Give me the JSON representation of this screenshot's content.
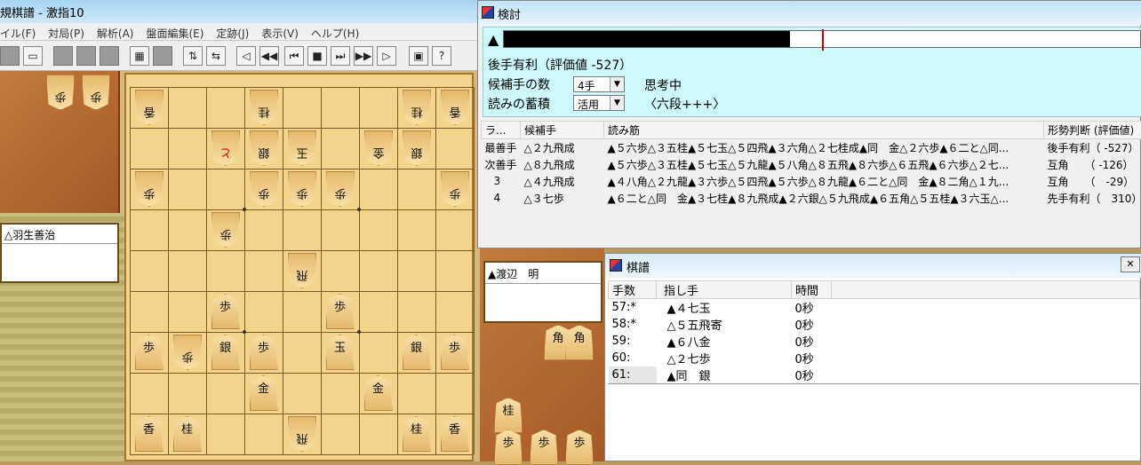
{
  "main_window": {
    "title": "規棋譜 - 激指10",
    "menu": [
      "イル(F)",
      "対局(P)",
      "解析(A)",
      "盤面編集(E)",
      "定跡(J)",
      "表示(V)",
      "ヘルプ(H)"
    ]
  },
  "players": {
    "gote_name": "△羽生善治",
    "sente_name": "▲渡辺　明"
  },
  "analysis_window": {
    "title": "検討",
    "mark": "▲",
    "eval_text": "後手有利（評価値 -527）",
    "candidates_label": "候補手の数",
    "candidates_value": "4手",
    "thinking_status": "思考中",
    "reading_label": "読みの蓄積",
    "reading_value": "活用",
    "strength": "〈六段+++〉",
    "columns": [
      "ラ...",
      "候補手",
      "読み筋",
      "形勢判断 (評価値)"
    ],
    "rows": [
      {
        "rank": "最善手",
        "move": "△２九飛成",
        "line": "▲５六歩△３五桂▲５七玉△５四飛▲３六角△２七桂成▲同　金△２六歩▲６二と△同...",
        "judge": "後手有利（ -527）"
      },
      {
        "rank": "次善手",
        "move": "△８九飛成",
        "line": "▲５六歩△３五桂▲５七玉△５九龍▲５八角△８五飛▲８六歩△６五飛▲６六歩△２七...",
        "judge": "互角　　（ -126）"
      },
      {
        "rank": "3",
        "move": "△４九飛成",
        "line": "▲４八角△２九龍▲３六歩△５四飛▲５六歩△８九龍▲６二と△同　金▲８二角△１九...",
        "judge": "互角　　（　-29）"
      },
      {
        "rank": "4",
        "move": "△３七歩",
        "line": "▲６二と△同　金▲３七桂▲８九飛成▲２六銀△５九飛成▲６五角△５五桂▲３六玉△...",
        "judge": "先手有利（　310）"
      }
    ],
    "eval_ratio": 0.45
  },
  "kifu_window": {
    "title": "棋譜",
    "columns": [
      "手数",
      "指し手",
      "時間"
    ],
    "rows": [
      {
        "num": "57:*",
        "move": "▲４七玉",
        "time": "0秒"
      },
      {
        "num": "58:*",
        "move": "△５五飛寄",
        "time": "0秒"
      },
      {
        "num": "59:",
        "move": "▲６八金",
        "time": "0秒"
      },
      {
        "num": "60:",
        "move": "△２七歩",
        "time": "0秒"
      },
      {
        "num": "61:",
        "move": "▲同　銀",
        "time": "0秒"
      }
    ]
  },
  "hands": {
    "gote": [
      "歩",
      "歩"
    ],
    "sente_top": [
      "角",
      "角"
    ],
    "sente_mid": [
      "桂"
    ],
    "sente_bot": [
      "歩",
      "歩",
      "歩"
    ]
  },
  "board": {
    "gote": [
      {
        "c": 0,
        "r": 0,
        "p": "香"
      },
      {
        "c": 3,
        "r": 0,
        "p": "桂"
      },
      {
        "c": 7,
        "r": 0,
        "p": "桂"
      },
      {
        "c": 8,
        "r": 0,
        "p": "香"
      },
      {
        "c": 3,
        "r": 1,
        "p": "銀"
      },
      {
        "c": 4,
        "r": 1,
        "p": "玉"
      },
      {
        "c": 6,
        "r": 1,
        "p": "金"
      },
      {
        "c": 7,
        "r": 1,
        "p": "銀"
      },
      {
        "c": 0,
        "r": 2,
        "p": "歩"
      },
      {
        "c": 3,
        "r": 2,
        "p": "歩"
      },
      {
        "c": 4,
        "r": 2,
        "p": "歩"
      },
      {
        "c": 5,
        "r": 2,
        "p": "歩"
      },
      {
        "c": 8,
        "r": 2,
        "p": "歩"
      },
      {
        "c": 2,
        "r": 3,
        "p": "歩"
      },
      {
        "c": 4,
        "r": 4,
        "p": "飛"
      },
      {
        "c": 1,
        "r": 6,
        "p": "歩"
      },
      {
        "c": 4,
        "r": 8,
        "p": "飛"
      }
    ],
    "gote_red": [
      {
        "c": 2,
        "r": 1,
        "p": "と"
      }
    ],
    "sente": [
      {
        "c": 2,
        "r": 5,
        "p": "歩"
      },
      {
        "c": 5,
        "r": 5,
        "p": "歩"
      },
      {
        "c": 0,
        "r": 6,
        "p": "歩"
      },
      {
        "c": 2,
        "r": 6,
        "p": "銀"
      },
      {
        "c": 3,
        "r": 6,
        "p": "歩"
      },
      {
        "c": 5,
        "r": 6,
        "p": "玉"
      },
      {
        "c": 7,
        "r": 6,
        "p": "銀"
      },
      {
        "c": 8,
        "r": 6,
        "p": "歩"
      },
      {
        "c": 3,
        "r": 7,
        "p": "金"
      },
      {
        "c": 6,
        "r": 7,
        "p": "金"
      },
      {
        "c": 0,
        "r": 8,
        "p": "香"
      },
      {
        "c": 1,
        "r": 8,
        "p": "桂"
      },
      {
        "c": 7,
        "r": 8,
        "p": "桂"
      },
      {
        "c": 8,
        "r": 8,
        "p": "香"
      }
    ]
  }
}
